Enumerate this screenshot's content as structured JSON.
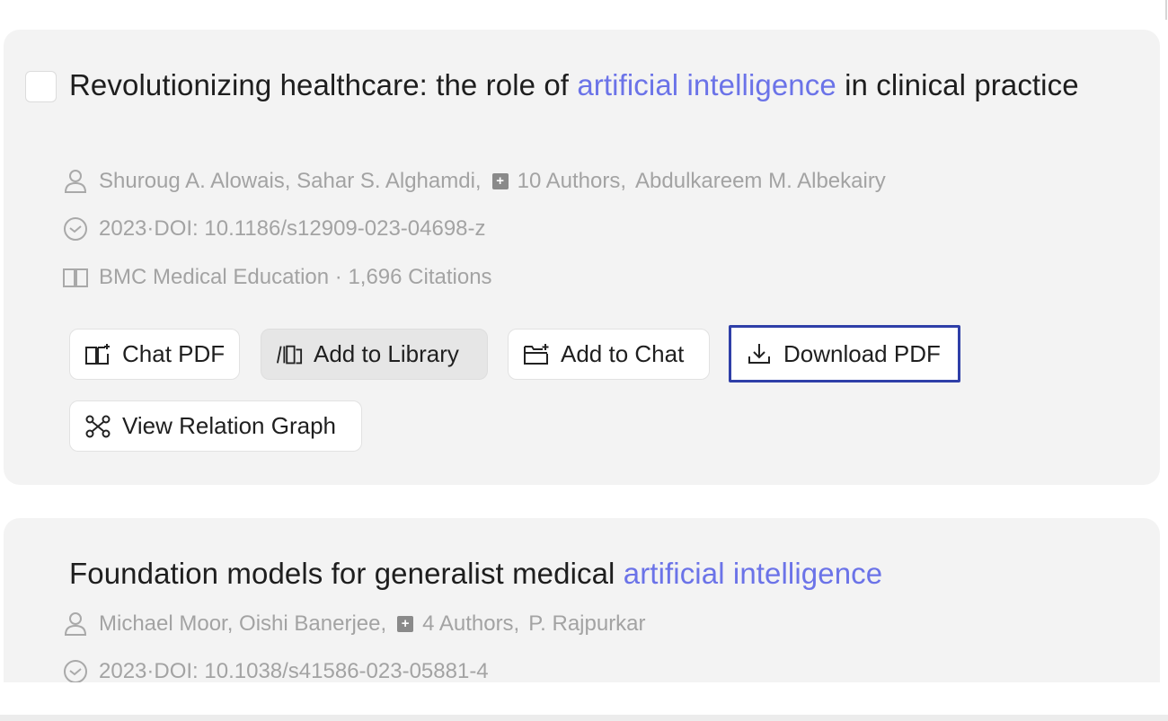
{
  "results": [
    {
      "title_prefix": "Revolutionizing healthcare: the role of ",
      "title_highlight": "artificial intelligence",
      "title_suffix": " in clinical practice",
      "authors_lead": "Shuroug A. Alowais,  Sahar S. Alghamdi,",
      "authors_more": "10 Authors,",
      "authors_last": "Abdulkareem M. Albekairy",
      "plus_glyph": "+",
      "year_doi": "2023·DOI: 10.1186/s12909-023-04698-z",
      "venue_citations": "BMC Medical Education · 1,696 Citations",
      "actions": {
        "chat_pdf": "Chat PDF",
        "add_library": "Add to Library",
        "add_chat": "Add to Chat",
        "download_pdf": "Download PDF",
        "relation_graph": "View Relation Graph"
      }
    },
    {
      "title_prefix": "Foundation models for generalist medical ",
      "title_highlight": "artificial intelligence",
      "title_suffix": "",
      "authors_lead": "Michael Moor,  Oishi Banerjee,",
      "authors_more": "4 Authors,",
      "authors_last": "P. Rajpurkar",
      "plus_glyph": "+",
      "year_doi": "2023·DOI: 10.1038/s41586-023-05881-4"
    }
  ],
  "colors": {
    "highlight": "#6b73e8",
    "focus_outline": "#2f3fa8",
    "card_bg": "#f3f3f3",
    "meta_text": "#a3a3a3"
  },
  "icons": [
    "user-icon",
    "clock-icon",
    "book-icon",
    "chat-pdf-icon",
    "library-icon",
    "folder-add-icon",
    "download-icon",
    "graph-icon",
    "plus-icon"
  ]
}
